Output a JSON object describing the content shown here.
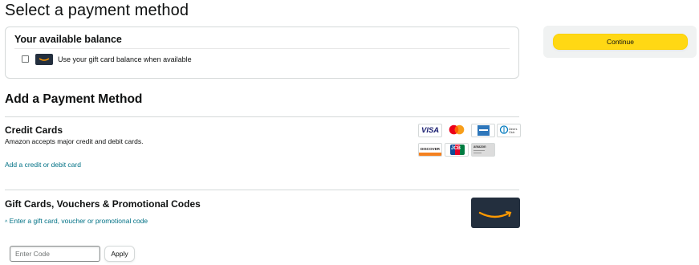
{
  "page_title": "Select a payment method",
  "balance": {
    "title": "Your available balance",
    "checkbox_label": "Use your gift card balance when available",
    "checked": false
  },
  "sidebar": {
    "continue_label": "Continue"
  },
  "add_method": {
    "title": "Add a Payment Method",
    "credit_cards": {
      "title": "Credit Cards",
      "description": "Amazon accepts major credit and debit cards.",
      "add_link": "Add a credit or debit card",
      "logos": [
        {
          "icon": "visa-icon",
          "text": "VISA"
        },
        {
          "icon": "mastercard-icon",
          "text": ""
        },
        {
          "icon": "amex-icon",
          "text": ""
        },
        {
          "icon": "diners-club-icon",
          "text": "Diners Club"
        },
        {
          "icon": "discover-icon",
          "text": "DISCOVER"
        },
        {
          "icon": "jcb-icon",
          "text": "JCB"
        },
        {
          "icon": "amazon-store-card-icon",
          "text": "amazon"
        }
      ]
    },
    "gift_cards": {
      "title": "Gift Cards, Vouchers & Promotional Codes",
      "toggle_link": "Enter a gift card, voucher or promotional code",
      "toggle_caret": "^",
      "code_placeholder": "Enter Code",
      "code_value": "",
      "apply_label": "Apply"
    }
  },
  "colors": {
    "accent_yellow": "#ffd814",
    "link_teal": "#007185",
    "amazon_dark": "#232f3e",
    "amazon_orange": "#ff9900"
  }
}
